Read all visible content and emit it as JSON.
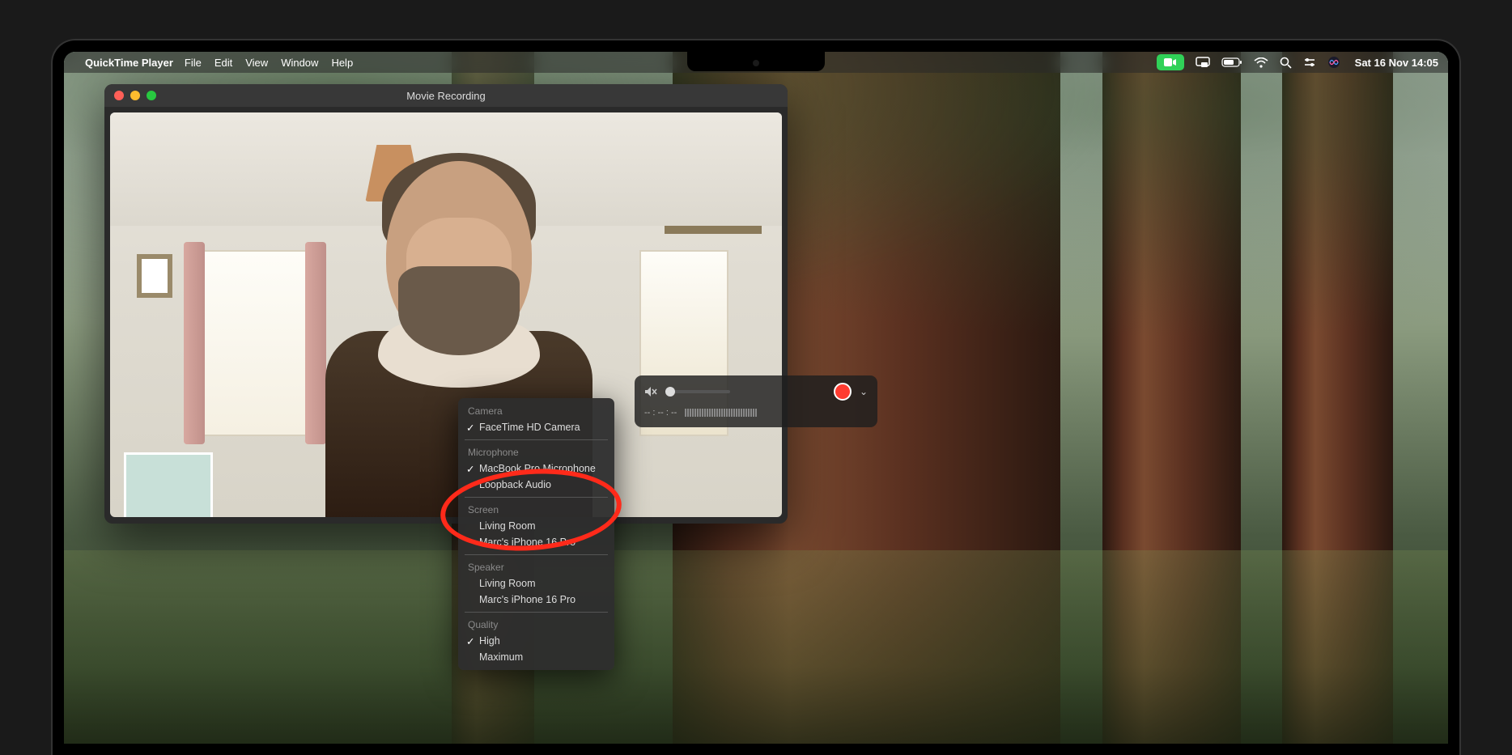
{
  "menubar": {
    "app_name": "QuickTime Player",
    "menus": [
      "File",
      "Edit",
      "View",
      "Window",
      "Help"
    ],
    "clock": "Sat 16 Nov  14:05"
  },
  "window": {
    "title": "Movie Recording"
  },
  "controls": {
    "time": "-- : -- : --"
  },
  "dropdown": {
    "camera_header": "Camera",
    "camera_items": [
      "FaceTime HD Camera"
    ],
    "camera_checked": 0,
    "mic_header": "Microphone",
    "mic_items": [
      "MacBook Pro Microphone",
      "Loopback Audio"
    ],
    "mic_checked": 0,
    "screen_header": "Screen",
    "screen_items": [
      "Living Room",
      "Marc's iPhone 16 Pro"
    ],
    "speaker_header": "Speaker",
    "speaker_items": [
      "Living Room",
      "Marc's iPhone 16 Pro"
    ],
    "quality_header": "Quality",
    "quality_items": [
      "High",
      "Maximum"
    ],
    "quality_checked": 0
  }
}
